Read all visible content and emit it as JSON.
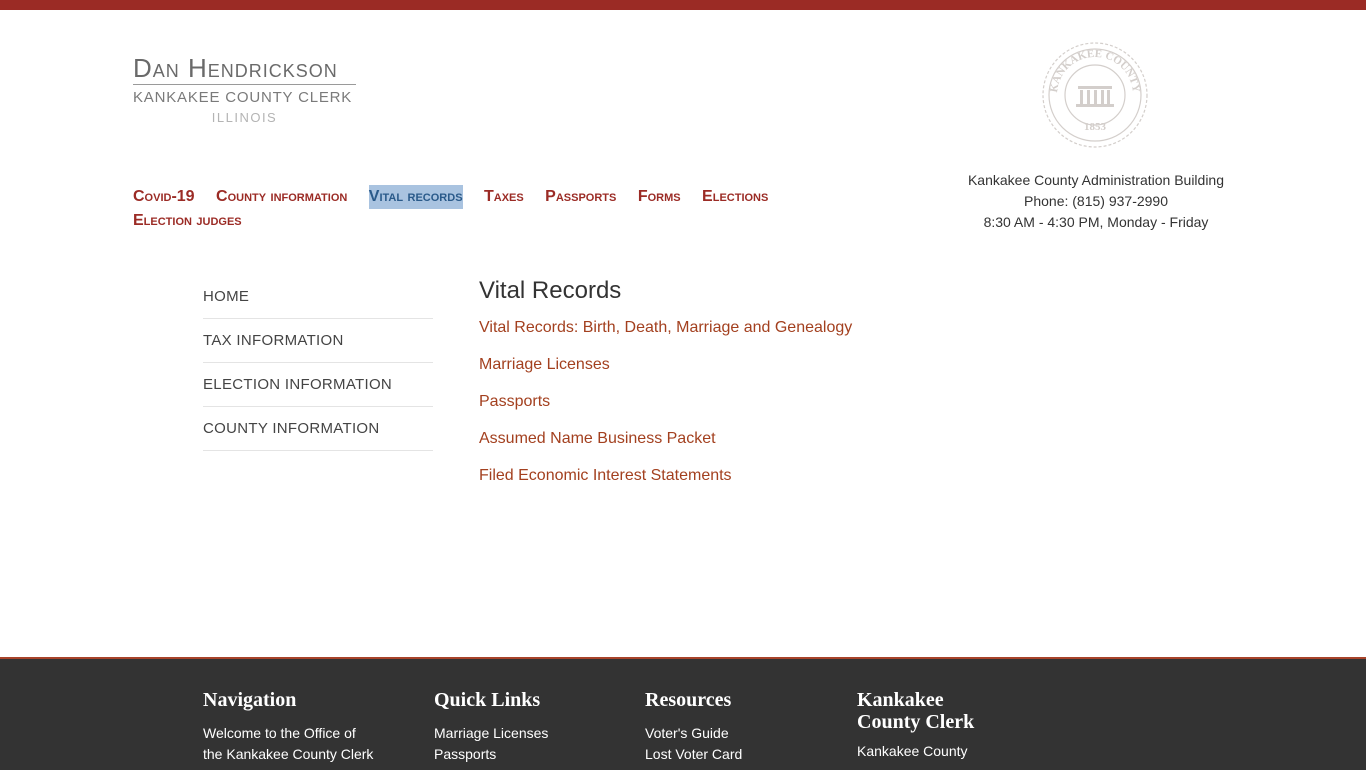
{
  "header": {
    "logo": {
      "name": "Dan Hendrickson",
      "title": "KANKAKEE COUNTY CLERK",
      "state": "ILLINOIS"
    },
    "seal": {
      "top_text": "KANKAKEE COUNTY",
      "year": "1853"
    },
    "contact": {
      "building": "Kankakee County Administration Building",
      "phone": "Phone: (815) 937-2990",
      "hours": "8:30 AM - 4:30 PM, Monday - Friday"
    }
  },
  "main_nav": {
    "items": [
      {
        "label": "Covid-19"
      },
      {
        "label": "County information"
      },
      {
        "label": "Vital records",
        "active": true
      },
      {
        "label": "Taxes"
      },
      {
        "label": "Passports"
      },
      {
        "label": "Forms"
      },
      {
        "label": "Elections"
      },
      {
        "label": "Election judges"
      }
    ]
  },
  "sidebar": {
    "items": [
      {
        "label": "HOME"
      },
      {
        "label": "TAX INFORMATION"
      },
      {
        "label": "ELECTION INFORMATION"
      },
      {
        "label": "COUNTY INFORMATION"
      }
    ]
  },
  "content": {
    "title": "Vital Records",
    "links": [
      {
        "label": "Vital Records: Birth, Death, Marriage and Genealogy"
      },
      {
        "label": "Marriage Licenses"
      },
      {
        "label": "Passports"
      },
      {
        "label": "Assumed Name Business Packet"
      },
      {
        "label": "Filed Economic Interest Statements"
      }
    ]
  },
  "footer": {
    "navigation": {
      "title": "Navigation",
      "line1": "Welcome to the Office of",
      "line2": "the Kankakee County Clerk"
    },
    "quick_links": {
      "title": "Quick Links",
      "items": [
        "Marriage Licenses",
        "Passports"
      ]
    },
    "resources": {
      "title": "Resources",
      "items": [
        "Voter's Guide",
        "Lost Voter Card"
      ]
    },
    "clerk": {
      "title_line1": "Kankakee",
      "title_line2": "County Clerk",
      "line1": "Kankakee County"
    }
  },
  "colors": {
    "brand_red": "#9b2b25",
    "link": "#a3401f",
    "footer_bg": "#333333"
  }
}
